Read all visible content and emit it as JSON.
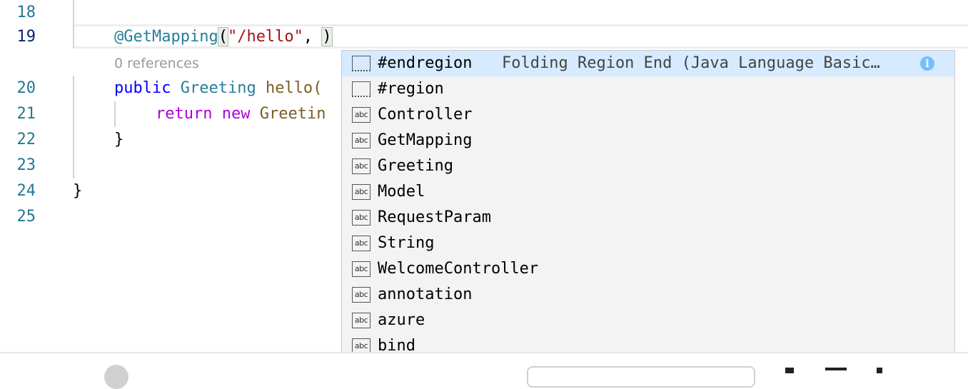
{
  "editor": {
    "lines": [
      {
        "number": "18"
      },
      {
        "number": "19",
        "anno": "@GetMapping",
        "paren_open": "(",
        "string": "\"/hello\"",
        "comma": ", ",
        "paren_close": ")"
      },
      {
        "number": "20",
        "kw": "public",
        "type": "Greeting",
        "fn": "hello("
      },
      {
        "number": "21",
        "kw": "return",
        "kw_new": "new",
        "type": "Greetin"
      },
      {
        "number": "22",
        "brace": "}"
      },
      {
        "number": "23"
      },
      {
        "number": "24",
        "brace": "}"
      },
      {
        "number": "25"
      }
    ],
    "codelens": "0 references"
  },
  "suggest": {
    "items": [
      {
        "label": "#endregion",
        "icon": "snippet-icon",
        "detail": "Folding Region End (Java Language Basic…",
        "selected": true
      },
      {
        "label": "#region",
        "icon": "snippet-icon"
      },
      {
        "label": "Controller",
        "icon": "text-icon"
      },
      {
        "label": "GetMapping",
        "icon": "text-icon"
      },
      {
        "label": "Greeting",
        "icon": "text-icon"
      },
      {
        "label": "Model",
        "icon": "text-icon"
      },
      {
        "label": "RequestParam",
        "icon": "text-icon"
      },
      {
        "label": "String",
        "icon": "text-icon"
      },
      {
        "label": "WelcomeController",
        "icon": "text-icon"
      },
      {
        "label": "annotation",
        "icon": "text-icon"
      },
      {
        "label": "azure",
        "icon": "text-icon"
      },
      {
        "label": "bind",
        "icon": "text-icon"
      }
    ],
    "text_icon_glyph": "abc",
    "info_glyph": "i"
  },
  "colors": {
    "line_number": "#237893",
    "keyword": "#0000ff",
    "control_keyword": "#af00db",
    "type": "#267f99",
    "function": "#795e26",
    "string": "#a31515",
    "selection": "#d6ebff",
    "info": "#75beff"
  }
}
